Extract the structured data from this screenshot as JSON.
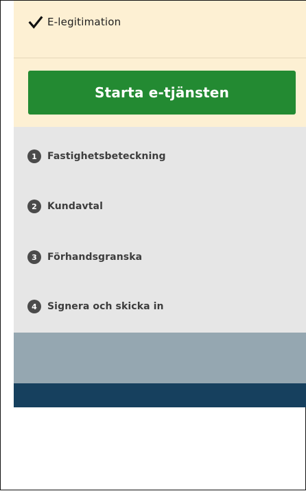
{
  "eleg": {
    "label": "E-legitimation",
    "icon": "check-icon"
  },
  "start_button": {
    "label": "Starta e-tjänsten",
    "color": "#238a32"
  },
  "steps": [
    {
      "number": "1",
      "label": "Fastighetsbeteckning"
    },
    {
      "number": "2",
      "label": "Kundavtal"
    },
    {
      "number": "3",
      "label": "Förhandsgranska"
    },
    {
      "number": "4",
      "label": "Signera och skicka in"
    }
  ],
  "colors": {
    "top_panel": "#fdf0d3",
    "steps_panel": "#e6e6e6",
    "gray_band": "#95a7b1",
    "navy_band": "#16405e"
  }
}
